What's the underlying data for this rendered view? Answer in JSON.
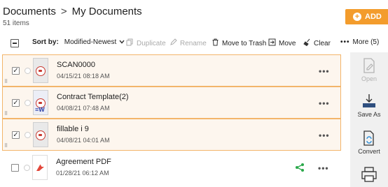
{
  "header": {
    "breadcrumb_root": "Documents",
    "breadcrumb_separator": ">",
    "breadcrumb_current": "My Documents",
    "item_count": "51 items",
    "add_button_label": "ADD"
  },
  "toolbar": {
    "sort_by_label": "Sort by:",
    "sort_value": "Modified-Newest",
    "duplicate": "Duplicate",
    "rename": "Rename",
    "move_to_trash": "Move to Trash",
    "move": "Move",
    "clear": "Clear",
    "more": "More (5)"
  },
  "files": [
    {
      "name": "SCAN0000",
      "date": "04/15/21 08:18 AM",
      "selected": true,
      "thumb": "scan"
    },
    {
      "name": "Contract Template(2)",
      "date": "04/08/21 07:48 AM",
      "selected": true,
      "thumb": "form"
    },
    {
      "name": "fillable i 9",
      "date": "04/08/21 04:01 AM",
      "selected": true,
      "thumb": "scan"
    },
    {
      "name": "Agreement PDF",
      "date": "01/28/21 06:12 AM",
      "selected": false,
      "thumb": "pdf"
    }
  ],
  "side_actions": {
    "open": "Open",
    "save_as": "Save As",
    "convert": "Convert"
  },
  "colors": {
    "accent": "#f39c2c",
    "selected_border": "#f3b56a",
    "share_green": "#2aa84a",
    "pdf_red": "#e2473a"
  },
  "icons": {
    "file_row_more": "more-horizontal-icon",
    "share": "share-icon",
    "add": "plus-circle-icon"
  }
}
